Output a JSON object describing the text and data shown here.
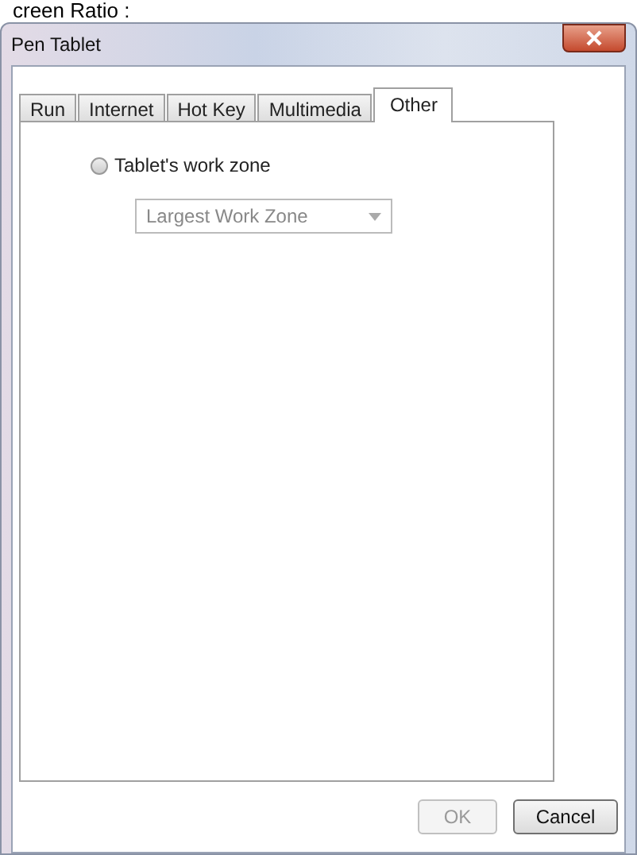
{
  "caption": "creen Ratio :",
  "window": {
    "title": "Pen Tablet"
  },
  "tabs": [
    {
      "label": "Run",
      "selected": false
    },
    {
      "label": "Internet",
      "selected": false
    },
    {
      "label": "Hot Key",
      "selected": false
    },
    {
      "label": "Multimedia",
      "selected": false
    },
    {
      "label": "Other",
      "selected": true
    }
  ],
  "radio": {
    "label": "Tablet's work zone",
    "checked": false
  },
  "dropdown": {
    "value": "Largest Work Zone",
    "disabled": true
  },
  "buttons": [
    {
      "label": "OK",
      "disabled": true
    },
    {
      "label": "Cancel",
      "disabled": false
    }
  ]
}
